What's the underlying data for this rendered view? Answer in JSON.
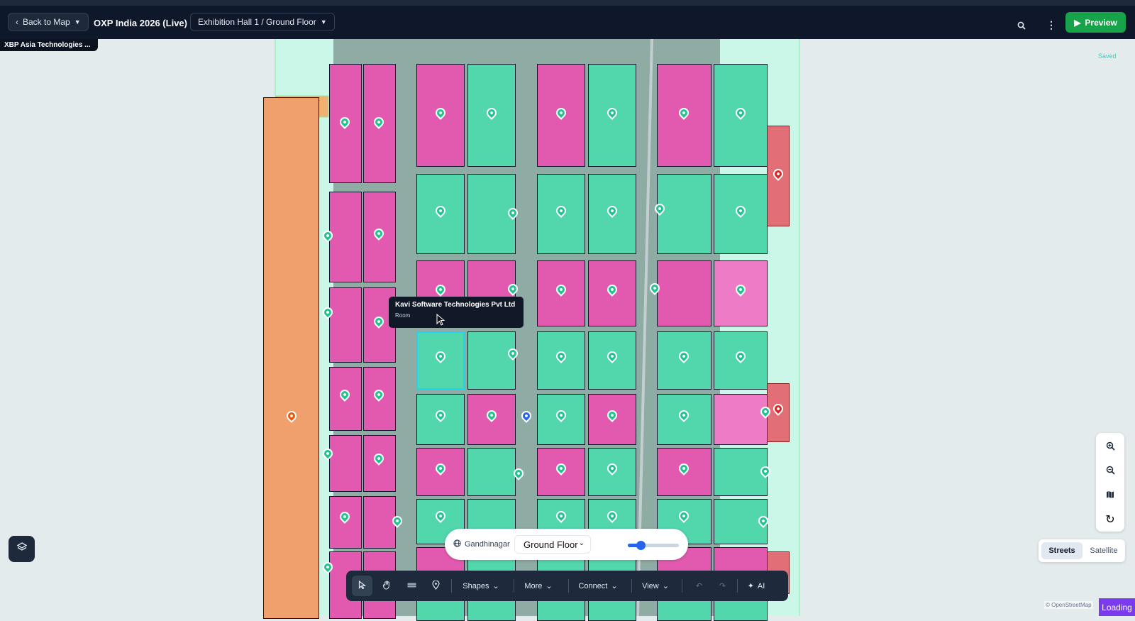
{
  "header": {
    "back_label": "Back to Map",
    "title": "OXP India 2026 (Live)",
    "floor_selector": "Exhibition Hall 1 / Ground Floor",
    "preview_label": "Preview",
    "search_icon": "search-icon",
    "more_icon": "more-vertical-icon"
  },
  "selected_chip": "XBP Asia Technologies ...",
  "save_status": "Saved",
  "tooltip": {
    "title": "Kavi Software Technologies Pvt Ltd",
    "type": "Room"
  },
  "floor_bar": {
    "location": "Gandhinagar",
    "floor_value": "Ground Floor",
    "opacity_level": 0.25
  },
  "toolbar": {
    "shapes_label": "Shapes",
    "more_label": "More",
    "connect_label": "Connect",
    "view_label": "View",
    "ai_label": "AI"
  },
  "basemap": {
    "streets_label": "Streets",
    "satellite_label": "Satellite"
  },
  "attribution": "© OpenStreetMap",
  "loading_label": "Loading",
  "colors": {
    "topbar": "#0f172a",
    "preview": "#16a34a",
    "booth_pink": "#e15ab0",
    "booth_teal": "#52d6ac",
    "booth_red": "#e26f78",
    "corridor": "#f0a06c",
    "hall_overlay": "#cbf7e8",
    "pin_green": "#1fc48e"
  }
}
